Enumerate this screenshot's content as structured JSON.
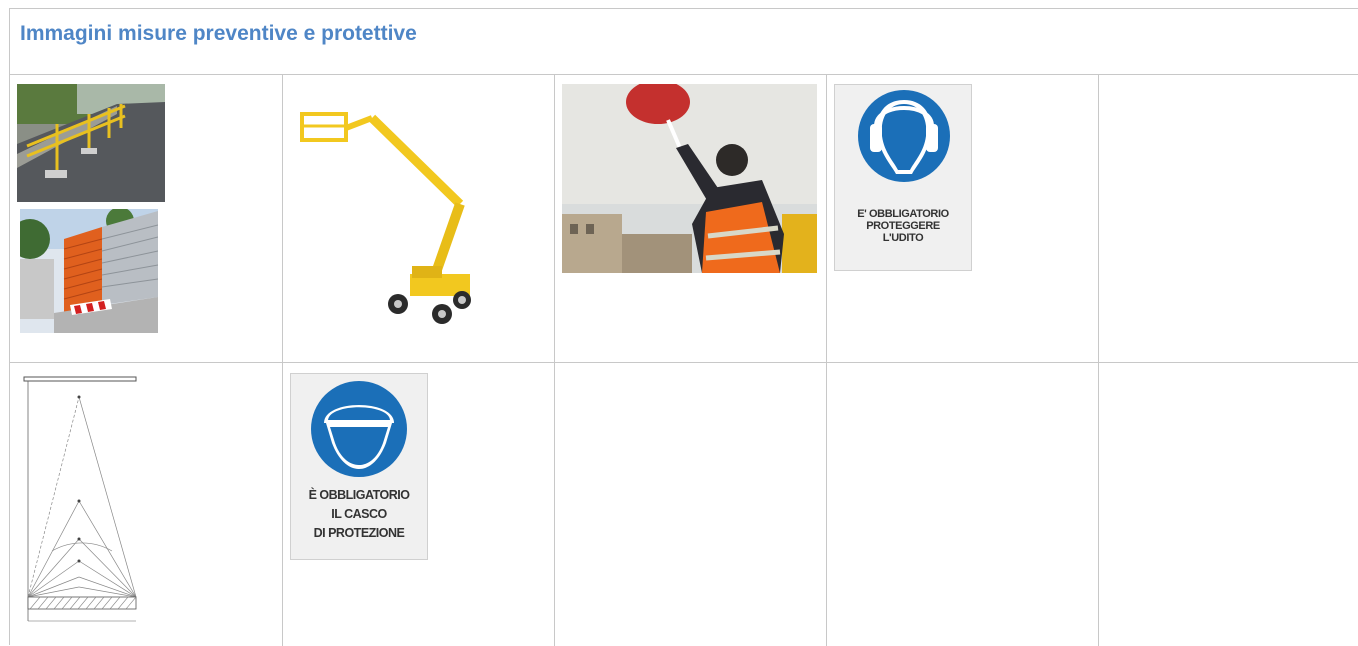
{
  "section": {
    "title": "Immagini misure preventive e protettive"
  },
  "signs": {
    "hearing": {
      "line1": "E' OBBLIGATORIO",
      "line2": "PROTEGGERE",
      "line3": "L'UDITO"
    },
    "helmet": {
      "line1": "È OBBLIGATORIO",
      "line2": "IL CASCO",
      "line3": "DI PROTEZIONE"
    }
  },
  "colors": {
    "title": "#4f86c6",
    "sign_blue": "#1b6fb8",
    "lift_yellow": "#f2c81f",
    "barrier_orange": "#e0601e"
  }
}
